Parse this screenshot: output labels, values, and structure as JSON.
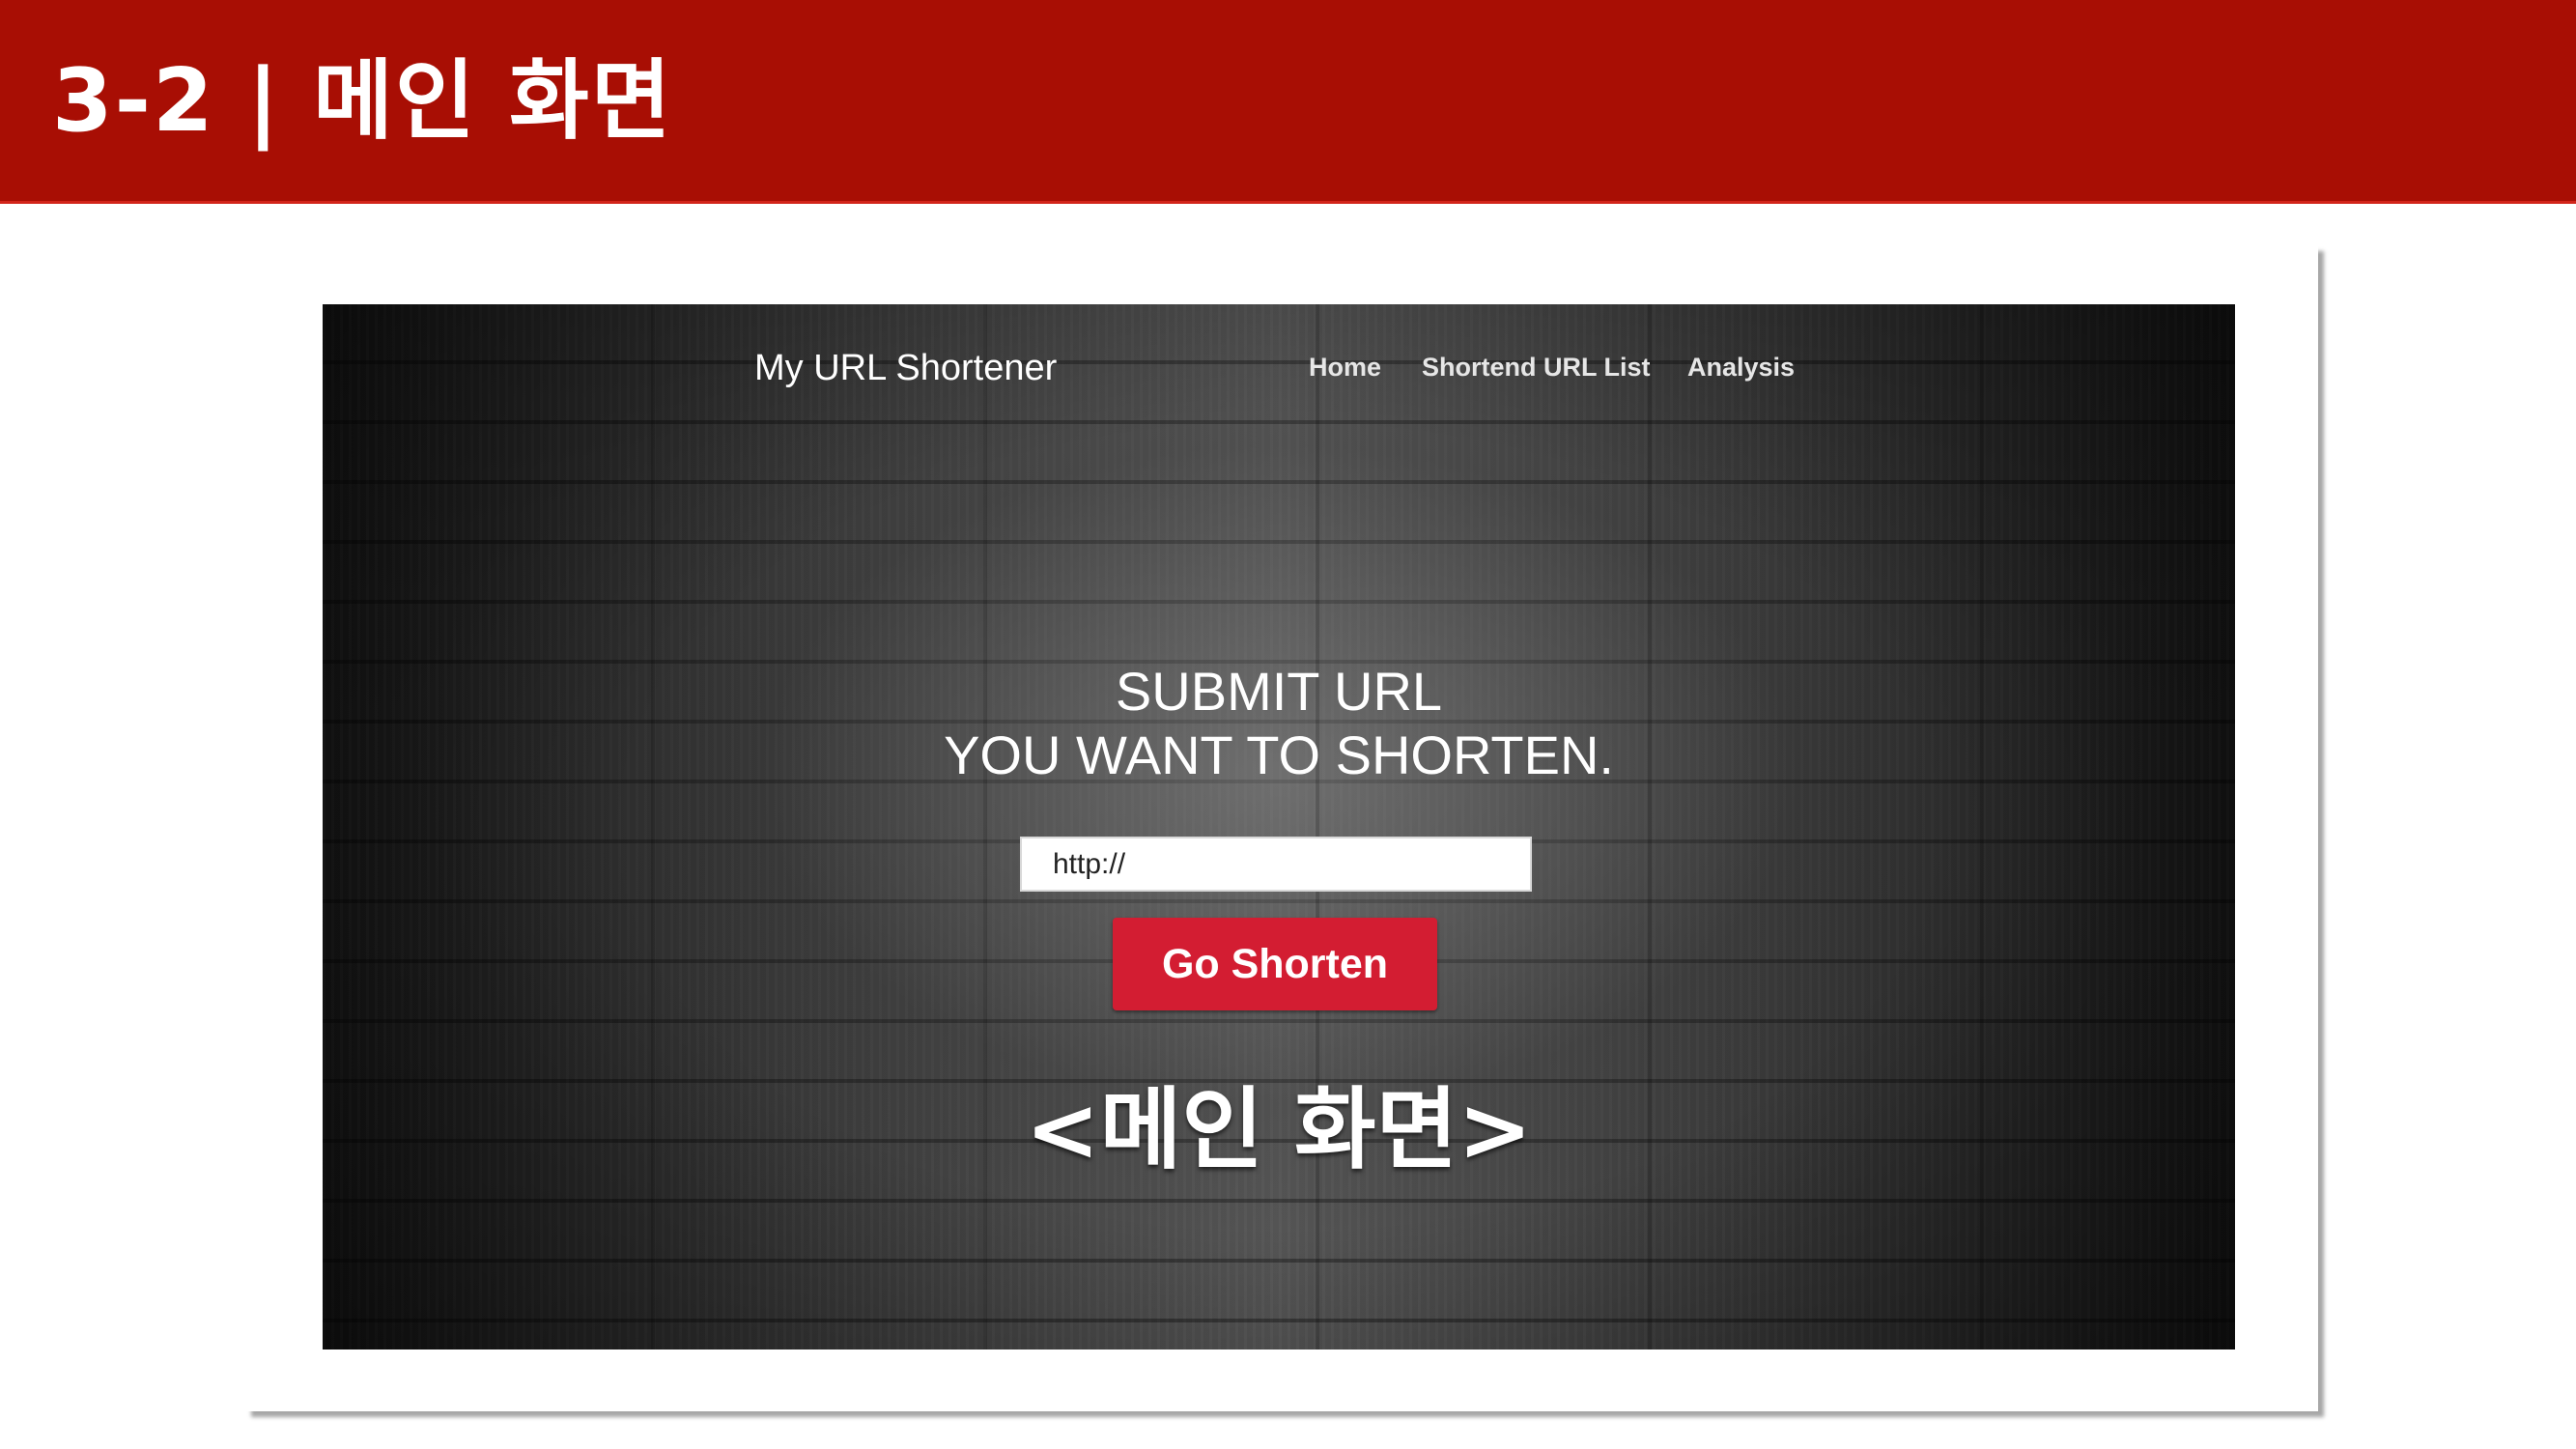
{
  "slide": {
    "title": "3-2 | 메인 화면"
  },
  "site": {
    "brand": "My URL Shortener",
    "nav": {
      "home": "Home",
      "list": "Shortend URL List",
      "analysis": "Analysis"
    },
    "headline_line1": "SUBMIT URL",
    "headline_line2": "YOU WANT TO SHORTEN.",
    "url_input": {
      "value": "http://"
    },
    "submit_label": "Go Shorten"
  },
  "caption": "<메인 화면>",
  "colors": {
    "header_red": "#a80e04",
    "button_red": "#d31d32"
  }
}
